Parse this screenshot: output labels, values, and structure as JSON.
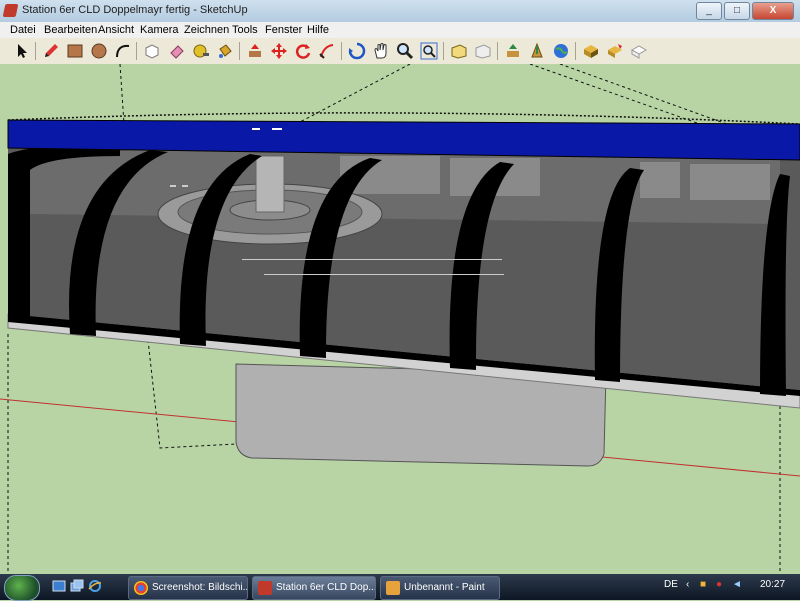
{
  "window": {
    "title": "Station 6er CLD Doppelmayr fertig - SketchUp",
    "min": "_",
    "max": "□",
    "close": "X"
  },
  "menu": [
    "Datei",
    "Bearbeiten",
    "Ansicht",
    "Kamera",
    "Zeichnen",
    "Tools",
    "Fenster",
    "Hilfe"
  ],
  "toolbar": {
    "icons": [
      "select-icon",
      "pencil-icon",
      "rectangle-icon",
      "circle-icon",
      "arc-icon",
      "make-component-icon",
      "eraser-icon",
      "tape-measure-icon",
      "paint-bucket-icon",
      "push-pull-icon",
      "move-icon",
      "rotate-icon",
      "follow-me-icon",
      "orbit-icon",
      "pan-icon",
      "zoom-icon",
      "zoom-extents-icon",
      "previous-view-icon",
      "next-view-icon",
      "get-models-icon",
      "share-model-icon",
      "google-earth-icon",
      "components-icon",
      "place-model-icon",
      "toggle-terrain-icon"
    ]
  },
  "colors": {
    "roof": "#0a18a8",
    "ground": "#b9d4a4",
    "structure": "#000000",
    "platform": "#cfcfcf",
    "foundation": "#b0b0b0",
    "axis_red": "#c03030"
  },
  "taskbar": {
    "tasks": [
      {
        "label": "Screenshot: Bildschi...",
        "icon": "chrome-icon"
      },
      {
        "label": "Station 6er CLD Dop...",
        "icon": "sketchup-icon"
      },
      {
        "label": "Unbenannt - Paint",
        "icon": "paint-icon"
      }
    ],
    "lang": "DE",
    "time": "20:27"
  }
}
